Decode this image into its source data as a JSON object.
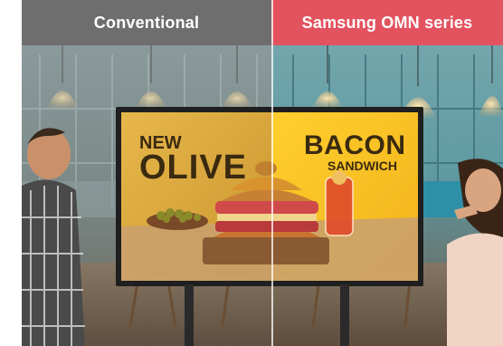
{
  "comparison": {
    "left_label": "Conventional",
    "right_label": "Samsung OMN series"
  },
  "signage": {
    "line1": "NEW",
    "line2": "OLIVE",
    "line3": "BACON",
    "line4": "SANDWICH"
  },
  "colors": {
    "left_header": "#6e6e6e",
    "right_header": "#e2535f",
    "sign_yellow": "#f5c43a"
  }
}
